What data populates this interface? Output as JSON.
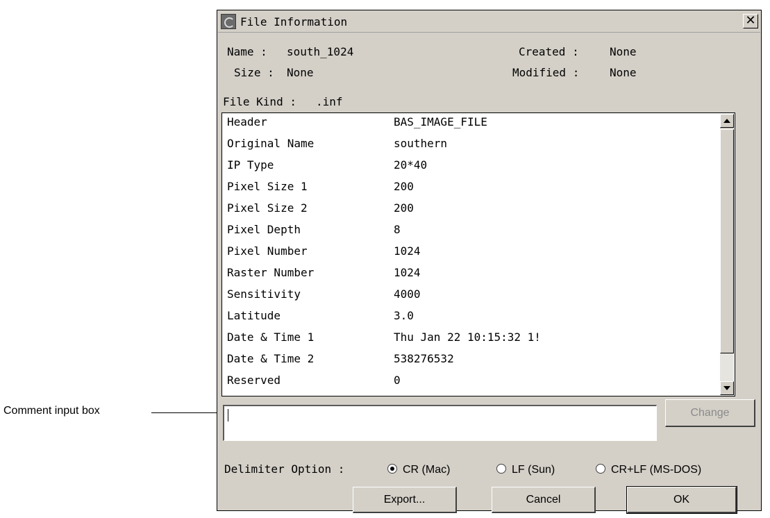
{
  "annotation": {
    "label": "Comment input  box"
  },
  "window": {
    "title": "File Information",
    "close_glyph": "✕",
    "icon": "app-icon"
  },
  "file": {
    "name_label": "Name :",
    "name_value": "south_1024",
    "size_label": "Size :",
    "size_value": "None",
    "created_label": "Created :",
    "created_value": "None",
    "modified_label": "Modified :",
    "modified_value": "None",
    "kind_label": "File Kind :",
    "kind_value": ".inf"
  },
  "properties": [
    {
      "key": "Header",
      "value": "BAS_IMAGE_FILE"
    },
    {
      "key": "Original Name",
      "value": "southern"
    },
    {
      "key": "IP Type",
      "value": "20*40"
    },
    {
      "key": "Pixel Size 1",
      "value": "200"
    },
    {
      "key": "Pixel Size 2",
      "value": "200"
    },
    {
      "key": "Pixel Depth",
      "value": "8"
    },
    {
      "key": "Pixel Number",
      "value": "1024"
    },
    {
      "key": "Raster Number",
      "value": "1024"
    },
    {
      "key": "Sensitivity",
      "value": "4000"
    },
    {
      "key": "Latitude",
      "value": "3.0"
    },
    {
      "key": "Date & Time 1",
      "value": "Thu Jan 22 10:15:32 1!"
    },
    {
      "key": "Date & Time 2",
      "value": "538276532"
    },
    {
      "key": "Reserved",
      "value": "0"
    }
  ],
  "comment": {
    "value": "",
    "placeholder": ""
  },
  "buttons": {
    "change": "Change",
    "export": "Export...",
    "cancel": "Cancel",
    "ok": "OK"
  },
  "delimiter": {
    "label": "Delimiter Option :",
    "options": [
      {
        "label": "CR (Mac)",
        "selected": true
      },
      {
        "label": "LF (Sun)",
        "selected": false
      },
      {
        "label": "CR+LF (MS-DOS)",
        "selected": false
      }
    ]
  }
}
